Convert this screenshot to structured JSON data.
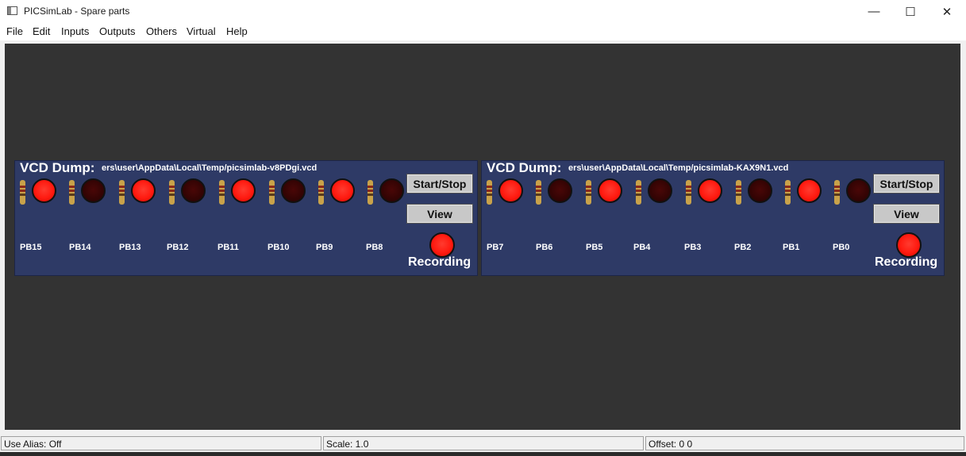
{
  "window": {
    "title": "PICSimLab - Spare parts",
    "minimize": "—",
    "maximize": "☐",
    "close": "✕"
  },
  "menu": [
    "File",
    "Edit",
    "Inputs",
    "Outputs",
    "Others",
    "Virtual",
    "Help"
  ],
  "panels": [
    {
      "vcd_label": "VCD Dump:",
      "file_path": "ers\\user\\AppData\\Local\\Temp/picsimlab-v8PDgi.vcd",
      "pins": [
        "PB15",
        "PB14",
        "PB13",
        "PB12",
        "PB11",
        "PB10",
        "PB9",
        "PB8"
      ],
      "led_states": [
        1,
        0,
        1,
        0,
        1,
        0,
        1,
        0
      ],
      "start_stop_label": "Start/Stop",
      "view_label": "View",
      "recording_label": "Recording"
    },
    {
      "vcd_label": "VCD Dump:",
      "file_path": "ers\\user\\AppData\\Local\\Temp/picsimlab-KAX9N1.vcd",
      "pins": [
        "PB7",
        "PB6",
        "PB5",
        "PB4",
        "PB3",
        "PB2",
        "PB1",
        "PB0"
      ],
      "led_states": [
        1,
        0,
        1,
        0,
        1,
        0,
        1,
        0
      ],
      "start_stop_label": "Start/Stop",
      "view_label": "View",
      "recording_label": "Recording"
    }
  ],
  "status": {
    "alias": "Use Alias: Off",
    "scale": "Scale: 1.0",
    "offset": "Offset:  0  0"
  },
  "colors": {
    "panel_bg": "#2e3a66",
    "canvas_bg": "#333333",
    "led_on": "#ff1a10",
    "led_off": "#330404"
  }
}
